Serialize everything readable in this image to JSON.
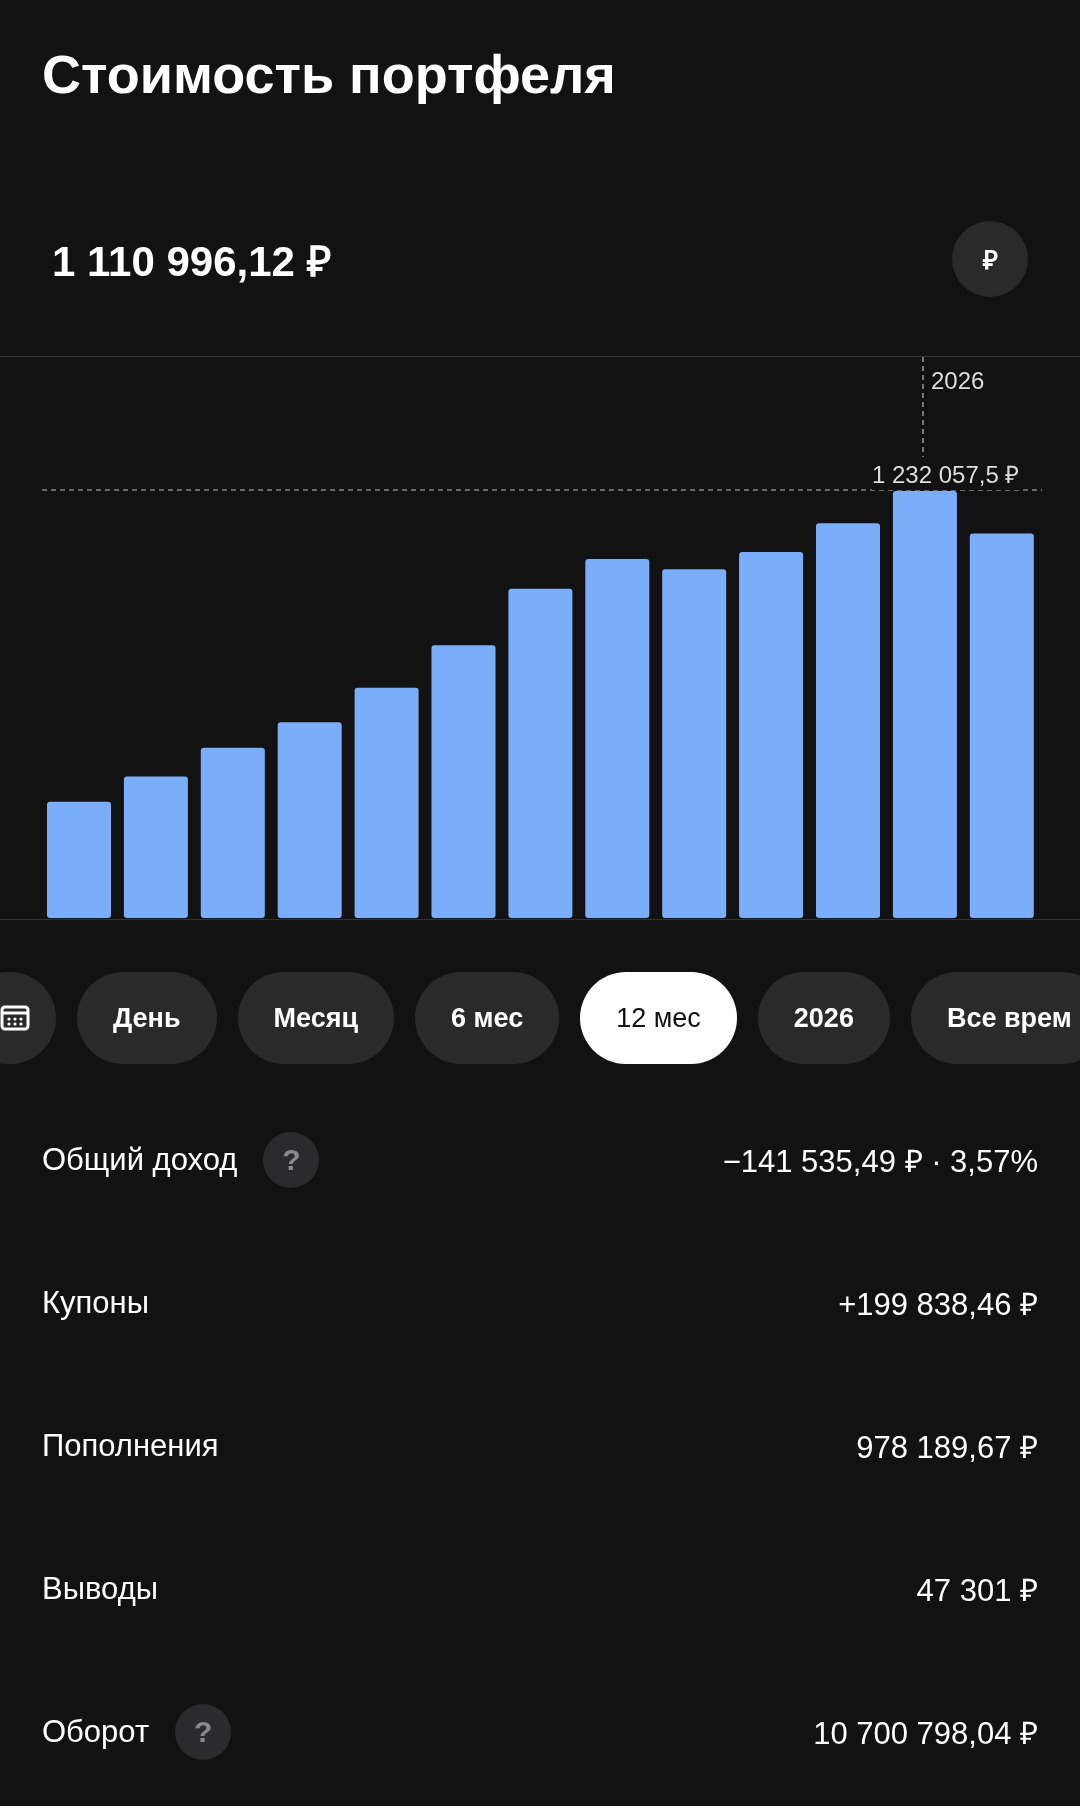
{
  "title": "Стоимость портфеля",
  "total": {
    "value": "1 110 996,12 ₽",
    "currency_button": "₽"
  },
  "chart": {
    "marker_label": "2026",
    "max_label": "1 232 057,5 ₽"
  },
  "periods": [
    {
      "label": "День",
      "selected": false
    },
    {
      "label": "Месяц",
      "selected": false
    },
    {
      "label": "6 мес",
      "selected": false
    },
    {
      "label": "12 мес",
      "selected": true
    },
    {
      "label": "2026",
      "selected": false
    },
    {
      "label": "Все врем",
      "selected": false
    }
  ],
  "stats": [
    {
      "label": "Общий доход",
      "help": "?",
      "value": "−141 535,49 ₽ · 3,57%"
    },
    {
      "label": "Купоны",
      "value": "+199 838,46 ₽"
    },
    {
      "label": "Пополнения",
      "value": "978 189,67 ₽"
    },
    {
      "label": "Выводы",
      "value": "47 301 ₽"
    },
    {
      "label": "Оборот",
      "help": "?",
      "value": "10 700 798,04 ₽"
    }
  ]
}
